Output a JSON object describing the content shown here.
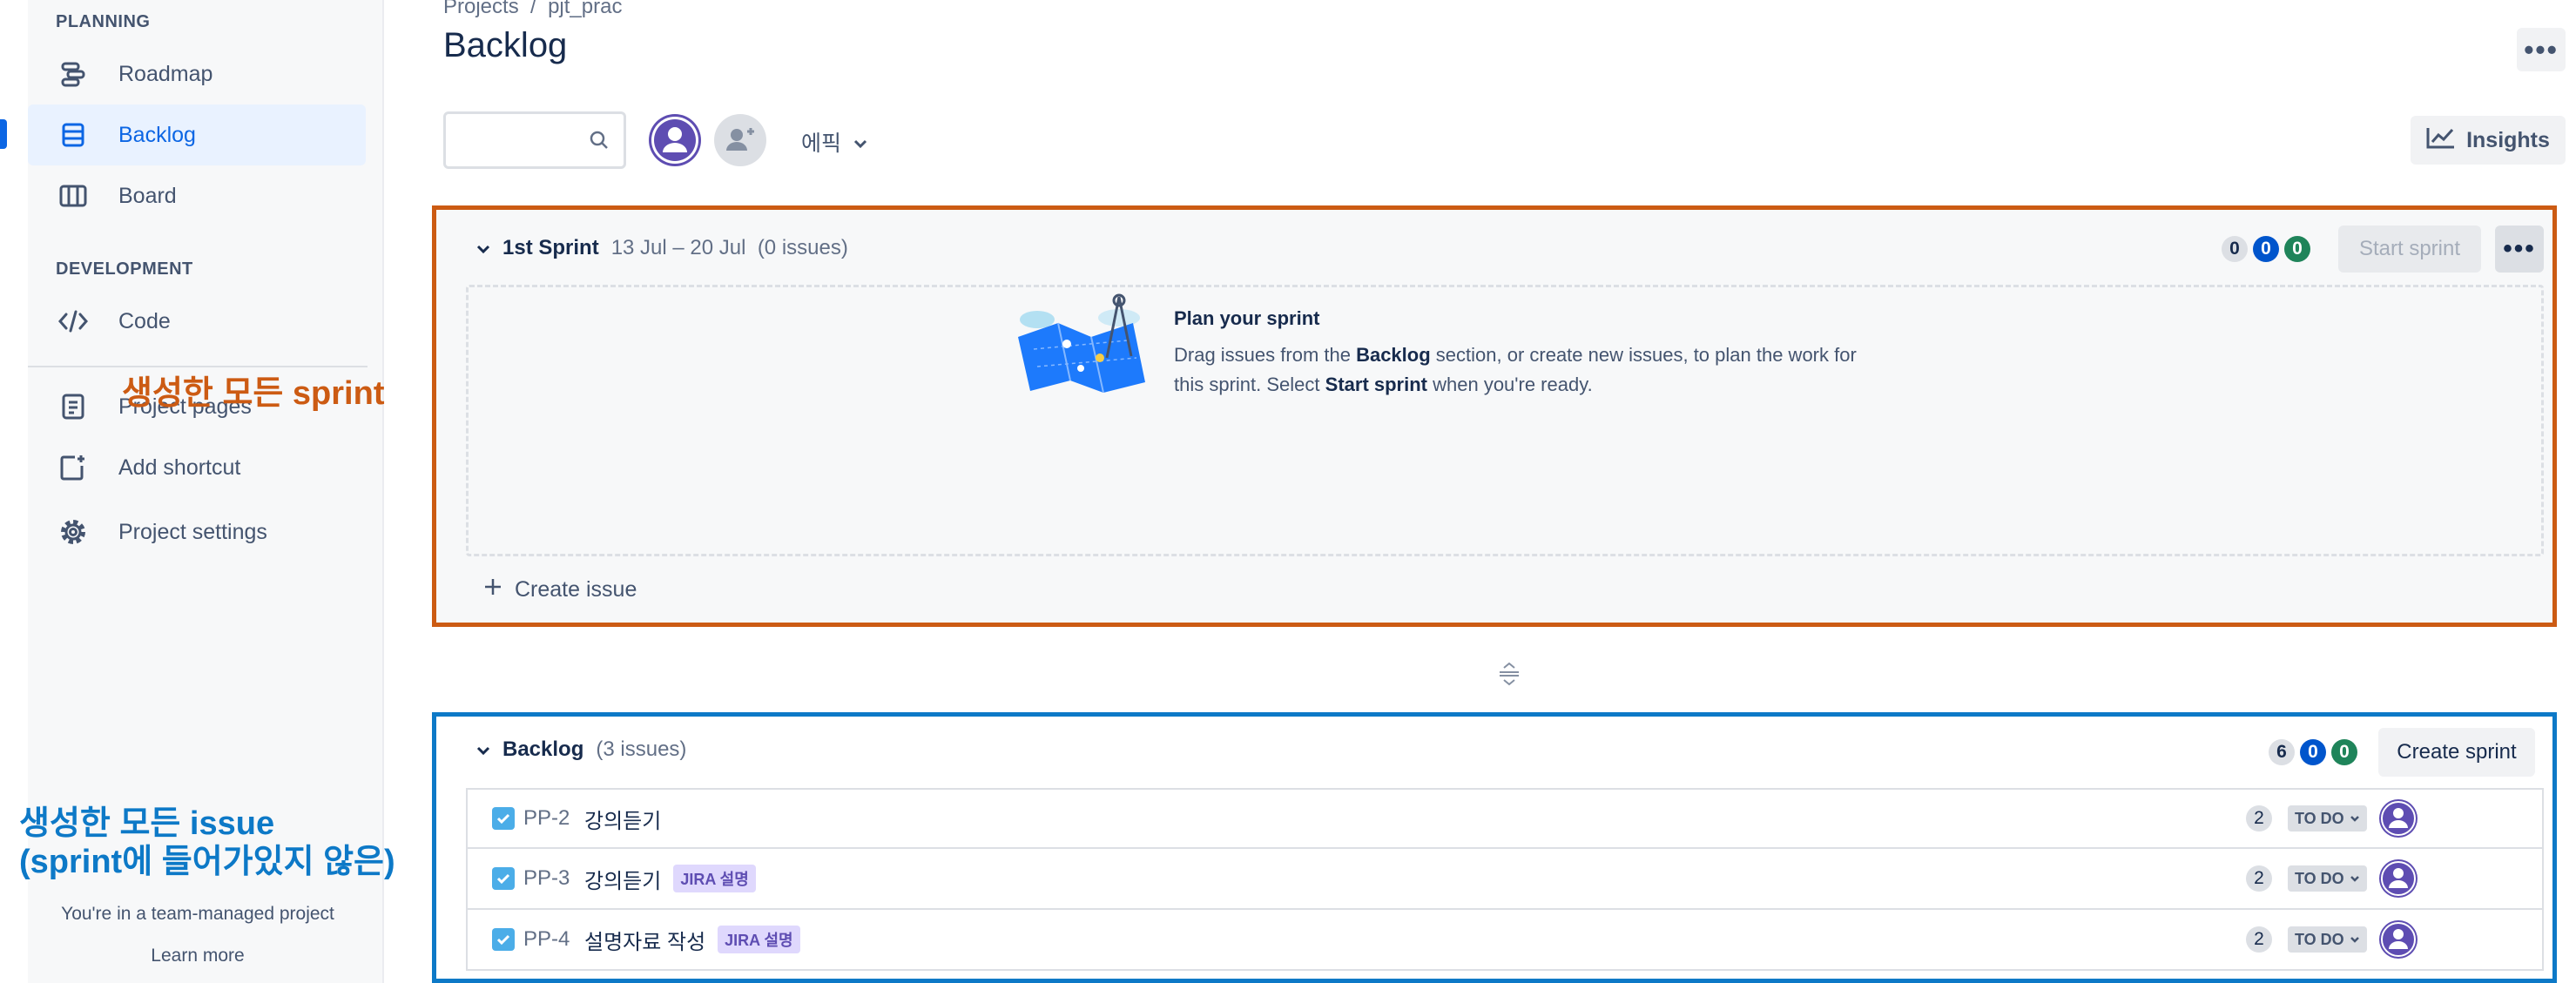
{
  "sidebar": {
    "planning_heading": "PLANNING",
    "items": [
      {
        "label": "Roadmap",
        "icon": "roadmap-icon"
      },
      {
        "label": "Backlog",
        "icon": "backlog-icon",
        "active": true
      },
      {
        "label": "Board",
        "icon": "board-icon"
      }
    ],
    "development_heading": "DEVELOPMENT",
    "dev_items": [
      {
        "label": "Code",
        "icon": "code-icon"
      }
    ],
    "extra_items": [
      {
        "label": "Project pages",
        "icon": "page-icon"
      },
      {
        "label": "Add shortcut",
        "icon": "add-shortcut-icon"
      },
      {
        "label": "Project settings",
        "icon": "gear-icon"
      }
    ],
    "footer_text": "You're in a team-managed project",
    "learn_more": "Learn more"
  },
  "header": {
    "breadcrumb": [
      "Projects",
      "/",
      "pjt_prac"
    ],
    "title": "Backlog",
    "more": "•••"
  },
  "toolbar": {
    "search_value": "",
    "epic_label": "에픽",
    "insights_label": "Insights"
  },
  "sprint": {
    "name": "1st Sprint",
    "dates": "13 Jul – 20 Jul",
    "issue_count": "(0 issues)",
    "counts": [
      "0",
      "0",
      "0"
    ],
    "start_label": "Start sprint",
    "more": "•••",
    "empty_title": "Plan your sprint",
    "empty_desc_1": "Drag issues from the ",
    "empty_desc_bold_1": "Backlog",
    "empty_desc_2": " section, or create new issues, to plan the work for this sprint. Select ",
    "empty_desc_bold_2": "Start sprint",
    "empty_desc_3": " when you're ready.",
    "create_issue": "Create issue"
  },
  "backlog": {
    "name": "Backlog",
    "issue_count": "(3 issues)",
    "counts": [
      "6",
      "0",
      "0"
    ],
    "create_sprint_label": "Create sprint",
    "issues": [
      {
        "key": "PP-2",
        "summary": "강의듣기",
        "label": "",
        "points": "2",
        "status": "TO DO"
      },
      {
        "key": "PP-3",
        "summary": "강의듣기",
        "label": "JIRA 설명",
        "points": "2",
        "status": "TO DO"
      },
      {
        "key": "PP-4",
        "summary": "설명자료 작성",
        "label": "JIRA 설명",
        "points": "2",
        "status": "TO DO"
      }
    ]
  },
  "annotations": {
    "sprint_note": "생성한 모든 sprint",
    "issue_note_line1": "생성한 모든 issue",
    "issue_note_line2": "(sprint에 들어가있지 않은)"
  },
  "colors": {
    "accent": "#0c66e4",
    "sprint_highlight": "#cc5b13",
    "backlog_highlight": "#0d79c7",
    "avatar": "#5e4db2"
  }
}
